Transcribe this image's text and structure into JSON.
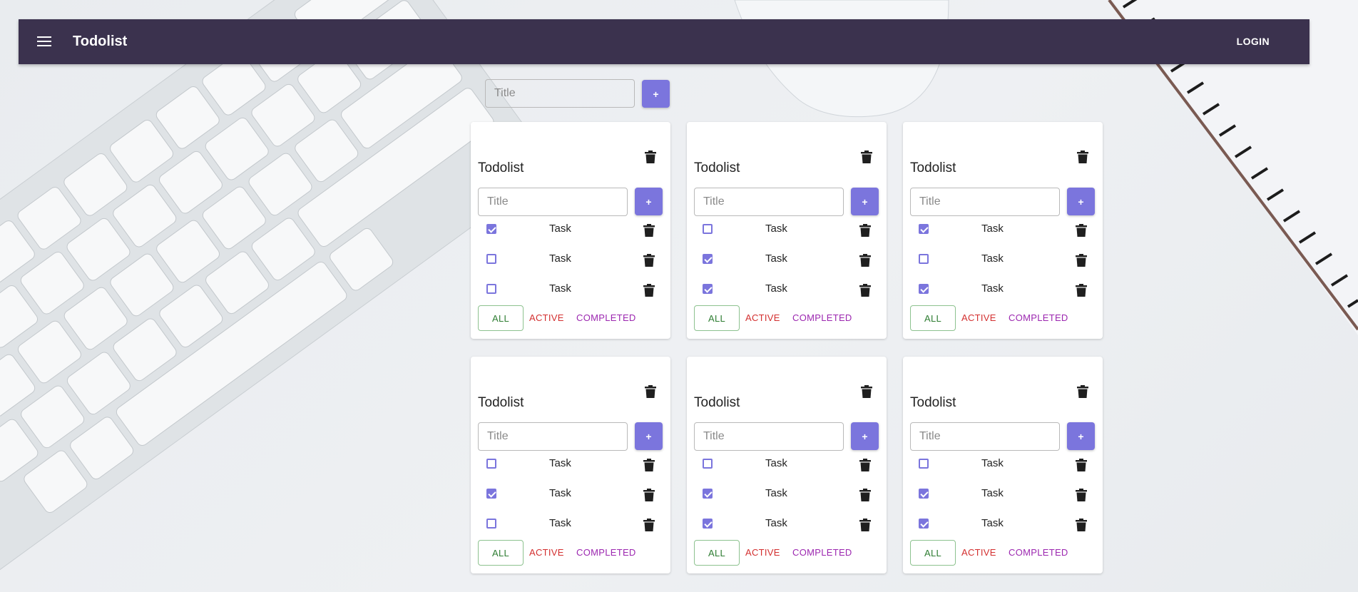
{
  "appbar": {
    "title": "Todolist",
    "login_label": "LOGIN"
  },
  "new_list": {
    "placeholder": "Title",
    "add_label": "+"
  },
  "filter_labels": {
    "all": "ALL",
    "active": "ACTIVE",
    "completed": "COMPLETED"
  },
  "colors": {
    "appbar": "#3b324e",
    "accent": "#7b75dd",
    "all": "#2e7d32",
    "active": "#d32f2f",
    "completed": "#9c27b0"
  },
  "icons": {
    "menu": "hamburger-menu-icon",
    "delete": "trash-icon"
  },
  "todolists": [
    {
      "title": "Todolist",
      "placeholder": "Title",
      "add_label": "+",
      "selected_filter": "all",
      "tasks": [
        {
          "text": "Task",
          "done": true
        },
        {
          "text": "Task",
          "done": false
        },
        {
          "text": "Task",
          "done": false
        }
      ]
    },
    {
      "title": "Todolist",
      "placeholder": "Title",
      "add_label": "+",
      "selected_filter": "all",
      "tasks": [
        {
          "text": "Task",
          "done": false
        },
        {
          "text": "Task",
          "done": true
        },
        {
          "text": "Task",
          "done": true
        }
      ]
    },
    {
      "title": "Todolist",
      "placeholder": "Title",
      "add_label": "+",
      "selected_filter": "all",
      "tasks": [
        {
          "text": "Task",
          "done": true
        },
        {
          "text": "Task",
          "done": false
        },
        {
          "text": "Task",
          "done": true
        }
      ]
    },
    {
      "title": "Todolist",
      "placeholder": "Title",
      "add_label": "+",
      "selected_filter": "all",
      "tasks": [
        {
          "text": "Task",
          "done": false
        },
        {
          "text": "Task",
          "done": true
        },
        {
          "text": "Task",
          "done": false
        }
      ]
    },
    {
      "title": "Todolist",
      "placeholder": "Title",
      "add_label": "+",
      "selected_filter": "all",
      "tasks": [
        {
          "text": "Task",
          "done": false
        },
        {
          "text": "Task",
          "done": true
        },
        {
          "text": "Task",
          "done": true
        }
      ]
    },
    {
      "title": "Todolist",
      "placeholder": "Title",
      "add_label": "+",
      "selected_filter": "all",
      "tasks": [
        {
          "text": "Task",
          "done": false
        },
        {
          "text": "Task",
          "done": true
        },
        {
          "text": "Task",
          "done": true
        }
      ]
    }
  ]
}
